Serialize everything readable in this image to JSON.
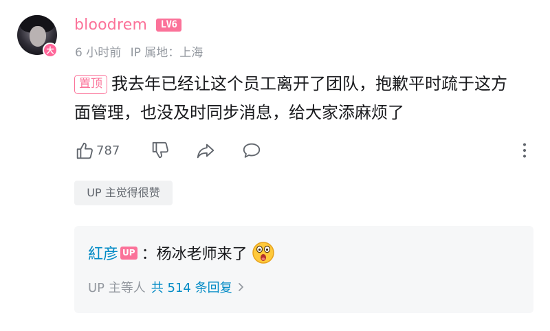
{
  "comment": {
    "username": "bloodrem",
    "level": "LV6",
    "avatar_badge": "大",
    "time": "6 小时前",
    "ip_location": "IP 属地：上海",
    "pin_label": "置顶",
    "text": "我去年已经让这个员工离开了团队，抱歉平时疏于这方面管理，也没及时同步消息，给大家添麻烦了",
    "like_count": "787",
    "up_liked_label": "UP 主觉得很赞"
  },
  "reply_preview": {
    "user": "紅彦",
    "up_tag": "UP",
    "text": "：杨冰老师来了",
    "emoji": "shocked-face-emoji",
    "summary_prefix": "UP 主等人",
    "summary_count": "共 514 条回复"
  },
  "colors": {
    "accent_pink": "#fb7299",
    "link_blue": "#008ac5",
    "muted_gray": "#9499a0",
    "text_dark": "#18191c"
  },
  "icons": [
    "thumb-up-icon",
    "thumb-down-icon",
    "share-icon",
    "reply-icon",
    "more-icon",
    "chevron-right-icon"
  ]
}
